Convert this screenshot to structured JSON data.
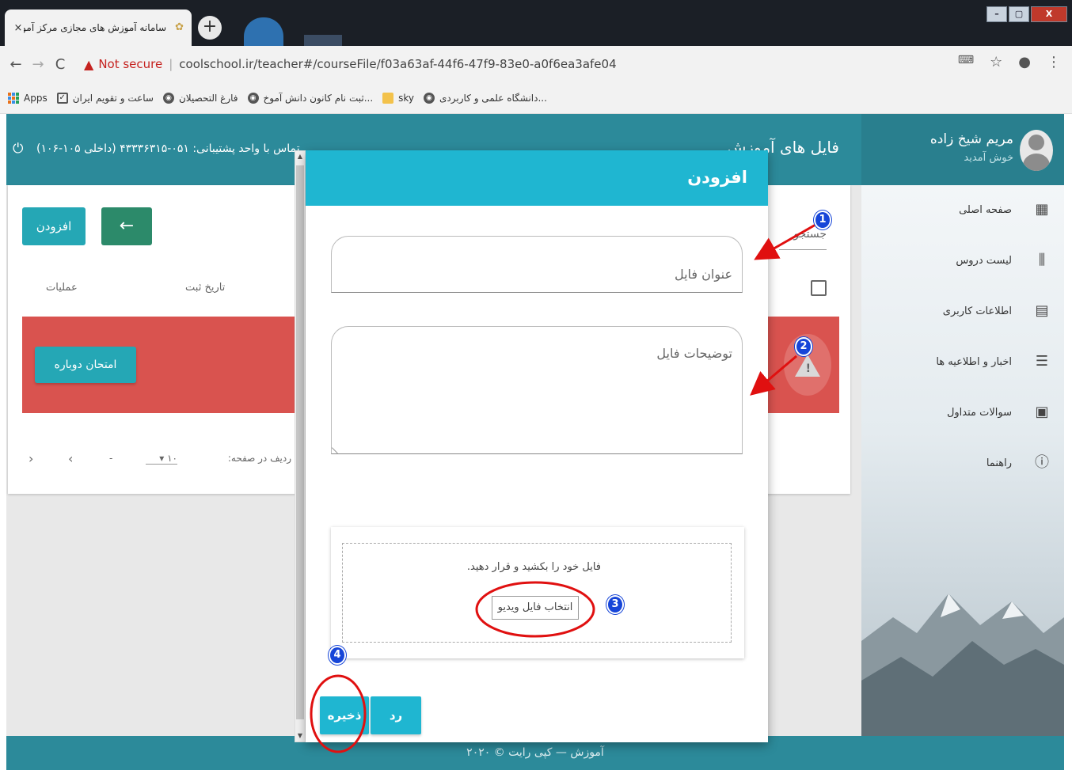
{
  "browser": {
    "tab_title": "سامانه آموزش های مجازی مرکز آموزش ...",
    "tab_close": "×",
    "new_tab": "+",
    "not_secure": "Not secure",
    "url": "coolschool.ir/teacher#/courseFile/f03a63af-44f6-47f9-83e0-a0f6ea3afe04",
    "bookmarks": [
      {
        "label": "Apps",
        "icon": "apps-grid-icon"
      },
      {
        "label": "ساعت و تقویم ایران",
        "icon": "checkbox-icon"
      },
      {
        "label": "فارغ التحصیلان",
        "icon": "globe-icon"
      },
      {
        "label": "ثبت نام کانون دانش آموخ...",
        "icon": "globe-icon"
      },
      {
        "label": "sky",
        "icon": "folder-icon"
      },
      {
        "label": "دانشگاه علمی و کاربردی...",
        "icon": "globe-icon"
      }
    ]
  },
  "header": {
    "user_name": "مریم شیخ زاده",
    "welcome": "خوش آمدید",
    "page_title": "فایل های آموزش",
    "support": "تماس با واحد پشتیبانی: ۰۵۱-۴۳۳۳۶۳۱۵ (داخلی ۱۰۵-۱۰۶)"
  },
  "sidebar": {
    "items": [
      {
        "label": "صفحه اصلی",
        "icon": "dashboard-icon"
      },
      {
        "label": "لیست دروس",
        "icon": "library-icon"
      },
      {
        "label": "اطلاعات کاربری",
        "icon": "id-card-icon"
      },
      {
        "label": "اخبار و اطلاعیه ها",
        "icon": "news-icon"
      },
      {
        "label": "سوالات متداول",
        "icon": "faq-icon"
      },
      {
        "label": "راهنما",
        "icon": "help-icon"
      }
    ]
  },
  "main": {
    "add_button": "افزودن",
    "search_placeholder": "جستجو",
    "columns": {
      "operations": "عملیات",
      "date": "تاریخ ثبت"
    },
    "retry_button": "امتحان دوباره",
    "pager": {
      "rows_label": "ردیف در صفحه:",
      "rows_value": "۱۰",
      "range": "-"
    }
  },
  "dialog": {
    "title": "افزودن",
    "file_title_placeholder": "عنوان فایل",
    "file_desc_placeholder": "توضیحات فایل",
    "drop_text": "فایل خود را بکشید و قرار دهید.",
    "pick_button": "انتخاب فایل ویدیو",
    "save_button": "ذخیره",
    "cancel_button": "رد"
  },
  "footer": {
    "text": "آموزش — کپی رایت © ۲۰۲۰"
  },
  "annotations": [
    "1",
    "2",
    "3",
    "4"
  ],
  "colors": {
    "header": "#2c8a9a",
    "dialog_accent": "#1fb6d1",
    "error": "#d9534f",
    "annotation": "#e01010",
    "badge": "#1645d8"
  }
}
